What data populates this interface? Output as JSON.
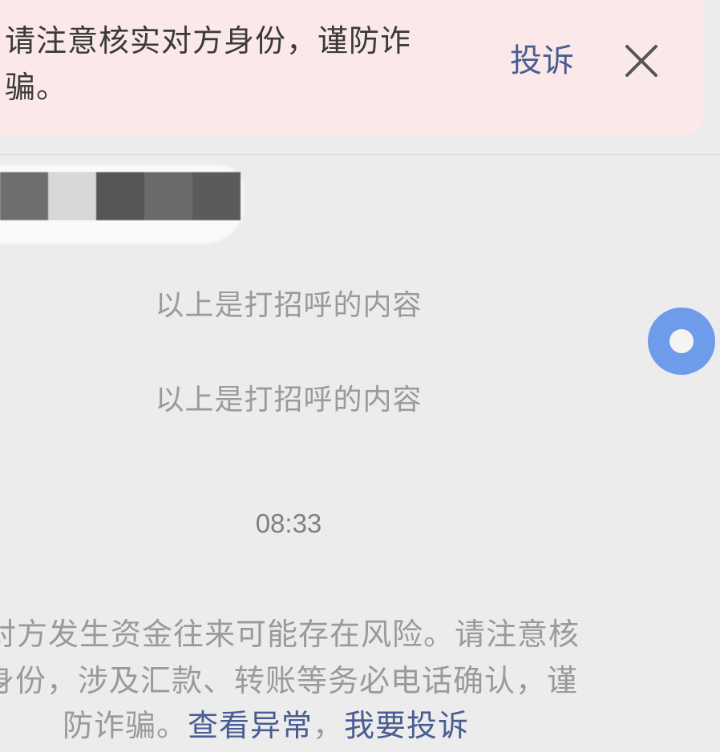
{
  "banner": {
    "text_line1": "请注意核实对方身份，谨防诈",
    "text_line2": "骗。",
    "complain_label": "投诉",
    "close_icon": "close-icon",
    "background": "#fbe9e9",
    "link_color": "#4a5d92"
  },
  "redacted_message": {
    "mosaic_colors": [
      "#6f6f6f",
      "#d7d7d7",
      "#565656",
      "#6a6a6a",
      "#5b5b5b"
    ]
  },
  "notices": [
    "以上是打招呼的内容",
    "以上是打招呼的内容"
  ],
  "timestamp": "08:33",
  "float_button": {
    "icon": "circle-ring-icon",
    "color": "#6e9bea"
  },
  "risk_warning": {
    "line1": "对方发生资金往来可能存在风险。请注意核",
    "line2": "身份，涉及汇款、转账等务必电话确认，谨",
    "line3_prefix": "防诈骗。",
    "link_view_anomaly": "查看异常",
    "separator": "，",
    "link_complain": "我要投诉"
  }
}
